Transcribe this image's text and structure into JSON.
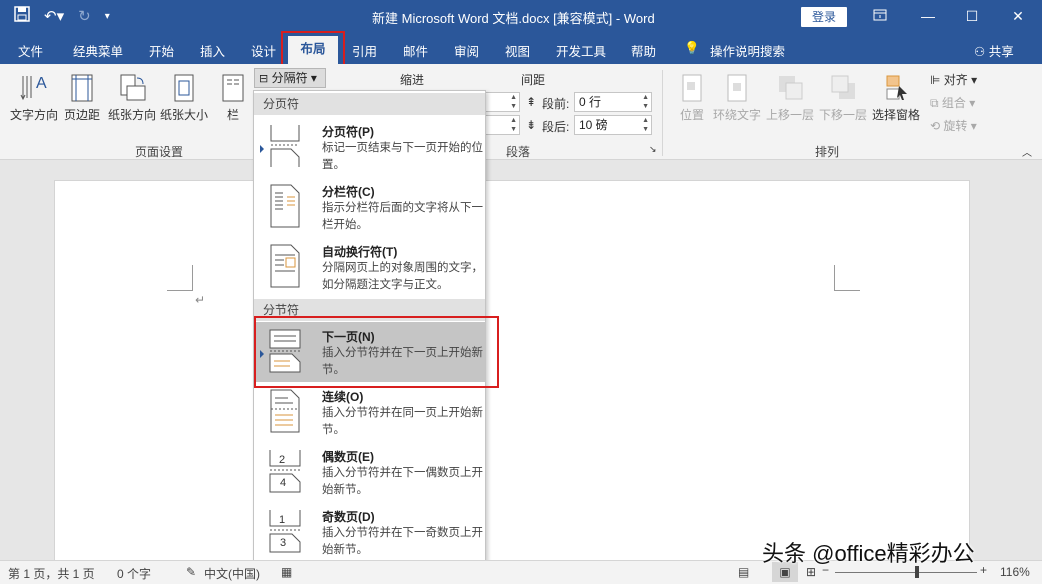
{
  "titlebar": {
    "title": "新建 Microsoft Word 文档.docx [兼容模式]  -  Word",
    "login": "登录",
    "qat_icons": [
      "save-icon",
      "undo-icon",
      "redo-icon",
      "customize-icon"
    ],
    "window_icons": [
      "ribbon-display-icon",
      "minimize-icon",
      "maximize-icon",
      "close-icon"
    ]
  },
  "tabs": [
    {
      "label": "文件"
    },
    {
      "label": "经典菜单"
    },
    {
      "label": "开始"
    },
    {
      "label": "插入"
    },
    {
      "label": "设计"
    },
    {
      "label": "布局"
    },
    {
      "label": "引用"
    },
    {
      "label": "邮件"
    },
    {
      "label": "审阅"
    },
    {
      "label": "视图"
    },
    {
      "label": "开发工具"
    },
    {
      "label": "帮助"
    },
    {
      "label": "操作说明搜索"
    }
  ],
  "share": "共享",
  "ribbon": {
    "page_setup": {
      "buttons": [
        "文字方向",
        "页边距",
        "纸张方向",
        "纸张大小",
        "栏"
      ],
      "group_label": "页面设置",
      "breaks_label": "分隔符"
    },
    "paragraph": {
      "indent_label": "缩进",
      "spacing_label": "间距",
      "before_label": "段前:",
      "before_value": "0 行",
      "after_label": "段后:",
      "after_value": "10 磅",
      "group_label": "段落"
    },
    "arrange": {
      "buttons": [
        "位置",
        "环绕文字",
        "上移一层",
        "下移一层",
        "选择窗格"
      ],
      "small": [
        "对齐",
        "组合",
        "旋转"
      ],
      "group_label": "排列"
    }
  },
  "menu": {
    "page_breaks_header": "分页符",
    "section_breaks_header": "分节符",
    "items": [
      {
        "title": "分页符(P)",
        "desc": "标记一页结束与下一页开始的位置。"
      },
      {
        "title": "分栏符(C)",
        "desc": "指示分栏符后面的文字将从下一栏开始。"
      },
      {
        "title": "自动换行符(T)",
        "desc": "分隔网页上的对象周围的文字，如分隔题注文字与正文。"
      },
      {
        "title": "下一页(N)",
        "desc": "插入分节符并在下一页上开始新节。"
      },
      {
        "title": "连续(O)",
        "desc": "插入分节符并在同一页上开始新节。"
      },
      {
        "title": "偶数页(E)",
        "desc": "插入分节符并在下一偶数页上开始新节。"
      },
      {
        "title": "奇数页(D)",
        "desc": "插入分节符并在下一奇数页上开始新节。"
      }
    ]
  },
  "document": {
    "paragraph_mark": "↵"
  },
  "statusbar": {
    "page": "第 1 页，共 1 页",
    "words": "0 个字",
    "language": "中文(中国)",
    "zoom": "116%",
    "zoom_level": 0.58
  },
  "watermark": "头条 @office精彩办公",
  "colors": {
    "accent": "#2b579a",
    "highlight": "#d81e1e",
    "selected_item": "#c5c5c5"
  }
}
